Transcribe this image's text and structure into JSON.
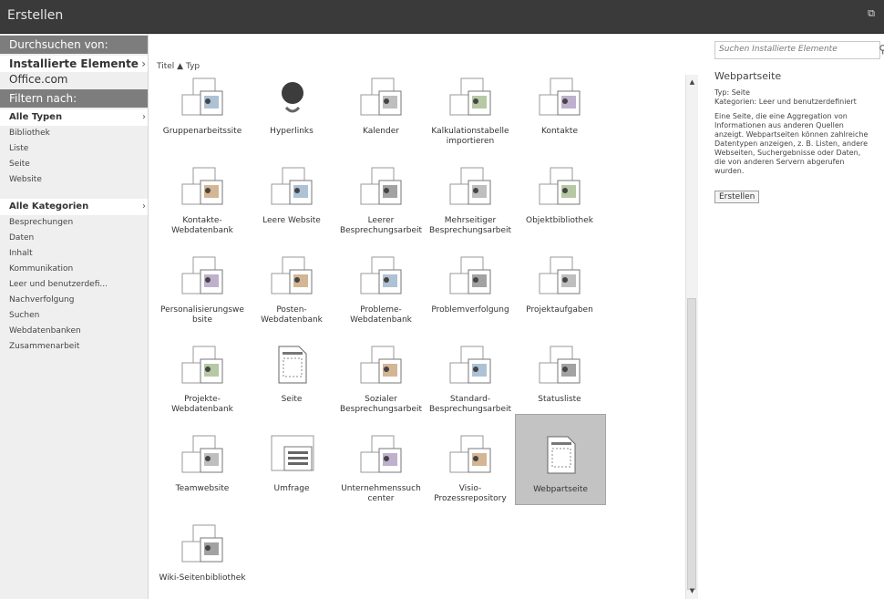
{
  "window": {
    "title": "Erstellen",
    "restore_glyph": "⧉"
  },
  "sidebar": {
    "browse_header": "Durchsuchen von:",
    "browse_selected": "Installierte Elemente",
    "browse_other": "Office.com",
    "filter_header": "Filtern nach:",
    "types_selected": "Alle Typen",
    "types": [
      "Bibliothek",
      "Liste",
      "Seite",
      "Website"
    ],
    "categories_selected": "Alle Kategorien",
    "categories": [
      "Besprechungen",
      "Daten",
      "Inhalt",
      "Kommunikation",
      "Leer und benutzerdefi...",
      "Nachverfolgung",
      "Suchen",
      "Webdatenbanken",
      "Zusammenarbeit"
    ],
    "chevron": "›"
  },
  "sort": {
    "title_label": "Titel",
    "arrow": "▲",
    "type_label": "Typ"
  },
  "tiles": [
    {
      "label": "Gruppenarbeitssite",
      "icon": "group-work-site-icon"
    },
    {
      "label": "Hyperlinks",
      "icon": "hyperlinks-icon"
    },
    {
      "label": "Kalender",
      "icon": "calendar-icon"
    },
    {
      "label": "Kalkulationstabelle importieren",
      "icon": "import-spreadsheet-icon"
    },
    {
      "label": "Kontakte",
      "icon": "contacts-icon"
    },
    {
      "label": "Kontakte-Webdatenbank",
      "icon": "contacts-web-database-icon"
    },
    {
      "label": "Leere Website",
      "icon": "blank-site-icon"
    },
    {
      "label": "Leerer Besprechungsarbeit",
      "icon": "blank-meeting-workspace-icon"
    },
    {
      "label": "Mehrseitiger Besprechungsarbeit",
      "icon": "multipage-meeting-workspace-icon"
    },
    {
      "label": "Objektbibliothek",
      "icon": "asset-library-icon"
    },
    {
      "label": "Personalisierungswe bsite",
      "icon": "personalization-site-icon"
    },
    {
      "label": "Posten-Webdatenbank",
      "icon": "charitable-web-database-icon"
    },
    {
      "label": "Probleme-Webdatenbank",
      "icon": "issues-web-database-icon"
    },
    {
      "label": "Problemverfolgung",
      "icon": "issue-tracking-icon"
    },
    {
      "label": "Projektaufgaben",
      "icon": "project-tasks-icon"
    },
    {
      "label": "Projekte-Webdatenbank",
      "icon": "projects-web-database-icon"
    },
    {
      "label": "Seite",
      "icon": "page-icon"
    },
    {
      "label": "Sozialer Besprechungsarbeit",
      "icon": "social-meeting-workspace-icon"
    },
    {
      "label": "Standard-Besprechungsarbeit",
      "icon": "basic-meeting-workspace-icon"
    },
    {
      "label": "Statusliste",
      "icon": "status-list-icon"
    },
    {
      "label": "Teamwebsite",
      "icon": "team-site-icon"
    },
    {
      "label": "Umfrage",
      "icon": "survey-icon"
    },
    {
      "label": "Unternehmenssuch center",
      "icon": "enterprise-search-center-icon"
    },
    {
      "label": "Visio-Prozessrepository",
      "icon": "visio-repository-icon"
    },
    {
      "label": "Webpartseite",
      "icon": "web-part-page-icon",
      "selected": true
    },
    {
      "label": "Wiki-Seitenbibliothek",
      "icon": "wiki-page-library-icon"
    }
  ],
  "details": {
    "search_placeholder": "Suchen Installierte Elemente",
    "title": "Webpartseite",
    "type_line": "Typ: Seite",
    "category_line": "Kategorien: Leer und benutzerdefiniert",
    "description": "Eine Seite, die eine Aggregation von Informationen aus anderen Quellen anzeigt. Webpartseiten können zahlreiche Datentypen anzeigen, z. B. Listen, andere Webseiten, Suchergebnisse oder Daten, die von anderen Servern abgerufen wurden.",
    "create_button": "Erstellen"
  },
  "colors": {
    "titlebar": "#3a3a3a",
    "sidebar_header": "#7d7d7d",
    "selected_tile": "#c3c3c3"
  }
}
